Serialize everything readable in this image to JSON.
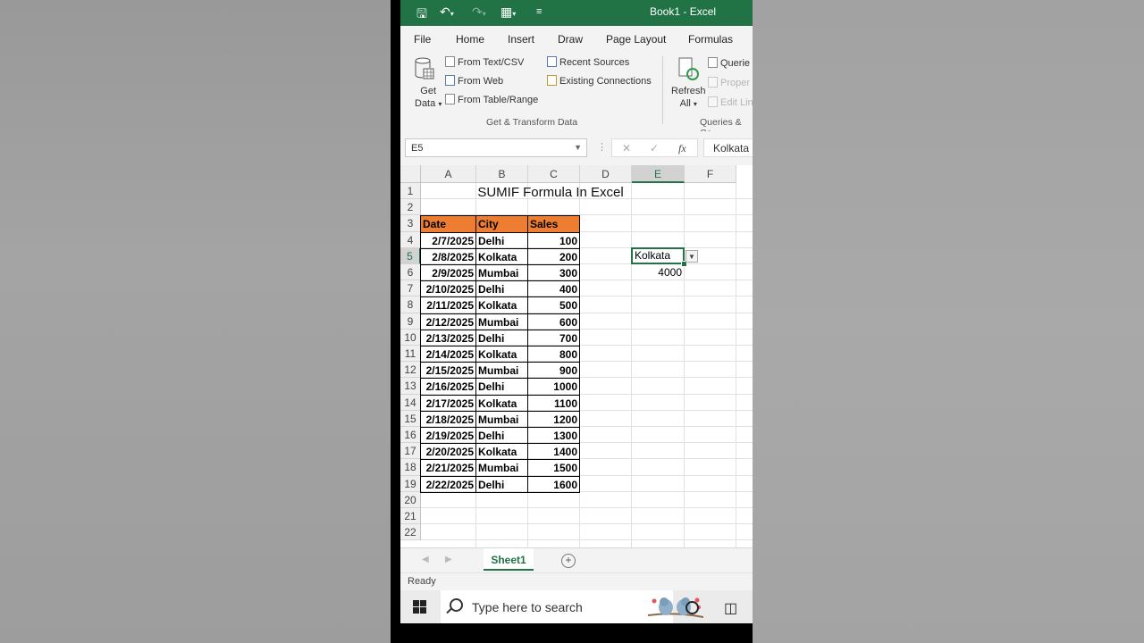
{
  "window": {
    "title": "Book1  -  Excel"
  },
  "ribbon_tabs": [
    "File",
    "Home",
    "Insert",
    "Draw",
    "Page Layout",
    "Formulas"
  ],
  "ribbon": {
    "get_data": [
      "Get",
      "Data"
    ],
    "items_col1": [
      "From Text/CSV",
      "From Web",
      "From Table/Range"
    ],
    "items_col2": [
      "Recent Sources",
      "Existing Connections"
    ],
    "refresh_all": [
      "Refresh",
      "All"
    ],
    "items_col3": [
      "Querie",
      "Proper",
      "Edit Lin"
    ],
    "group1_label": "Get & Transform Data",
    "group2_label": "Queries & Co"
  },
  "formula_bar": {
    "name_box": "E5",
    "formula": "Kolkata",
    "fx": "fx"
  },
  "columns": [
    "A",
    "B",
    "C",
    "D",
    "E",
    "F"
  ],
  "selected_column": "E",
  "rows": [
    1,
    2,
    3,
    4,
    5,
    6,
    7,
    8,
    9,
    10,
    11,
    12,
    13,
    14,
    15,
    16,
    17,
    18,
    19,
    20,
    21,
    22
  ],
  "selected_row": 5,
  "sheet_title": "SUMIF Formula In Excel",
  "table": {
    "headers": [
      "Date",
      "City",
      "Sales"
    ],
    "rows": [
      [
        "2/7/2025",
        "Delhi",
        "100"
      ],
      [
        "2/8/2025",
        "Kolkata",
        "200"
      ],
      [
        "2/9/2025",
        "Mumbai",
        "300"
      ],
      [
        "2/10/2025",
        "Delhi",
        "400"
      ],
      [
        "2/11/2025",
        "Kolkata",
        "500"
      ],
      [
        "2/12/2025",
        "Mumbai",
        "600"
      ],
      [
        "2/13/2025",
        "Delhi",
        "700"
      ],
      [
        "2/14/2025",
        "Kolkata",
        "800"
      ],
      [
        "2/15/2025",
        "Mumbai",
        "900"
      ],
      [
        "2/16/2025",
        "Delhi",
        "1000"
      ],
      [
        "2/17/2025",
        "Kolkata",
        "1100"
      ],
      [
        "2/18/2025",
        "Mumbai",
        "1200"
      ],
      [
        "2/19/2025",
        "Delhi",
        "1300"
      ],
      [
        "2/20/2025",
        "Kolkata",
        "1400"
      ],
      [
        "2/21/2025",
        "Mumbai",
        "1500"
      ],
      [
        "2/22/2025",
        "Delhi",
        "1600"
      ]
    ]
  },
  "criteria_cell": {
    "address": "E5",
    "value": "Kolkata"
  },
  "result_cell": {
    "address": "E6",
    "value": "4000"
  },
  "sheet_tab": "Sheet1",
  "status": "Ready",
  "taskbar": {
    "search_placeholder": "Type here to search"
  },
  "colors": {
    "excel_green": "#217346",
    "header_fill": "#ed7d31"
  }
}
